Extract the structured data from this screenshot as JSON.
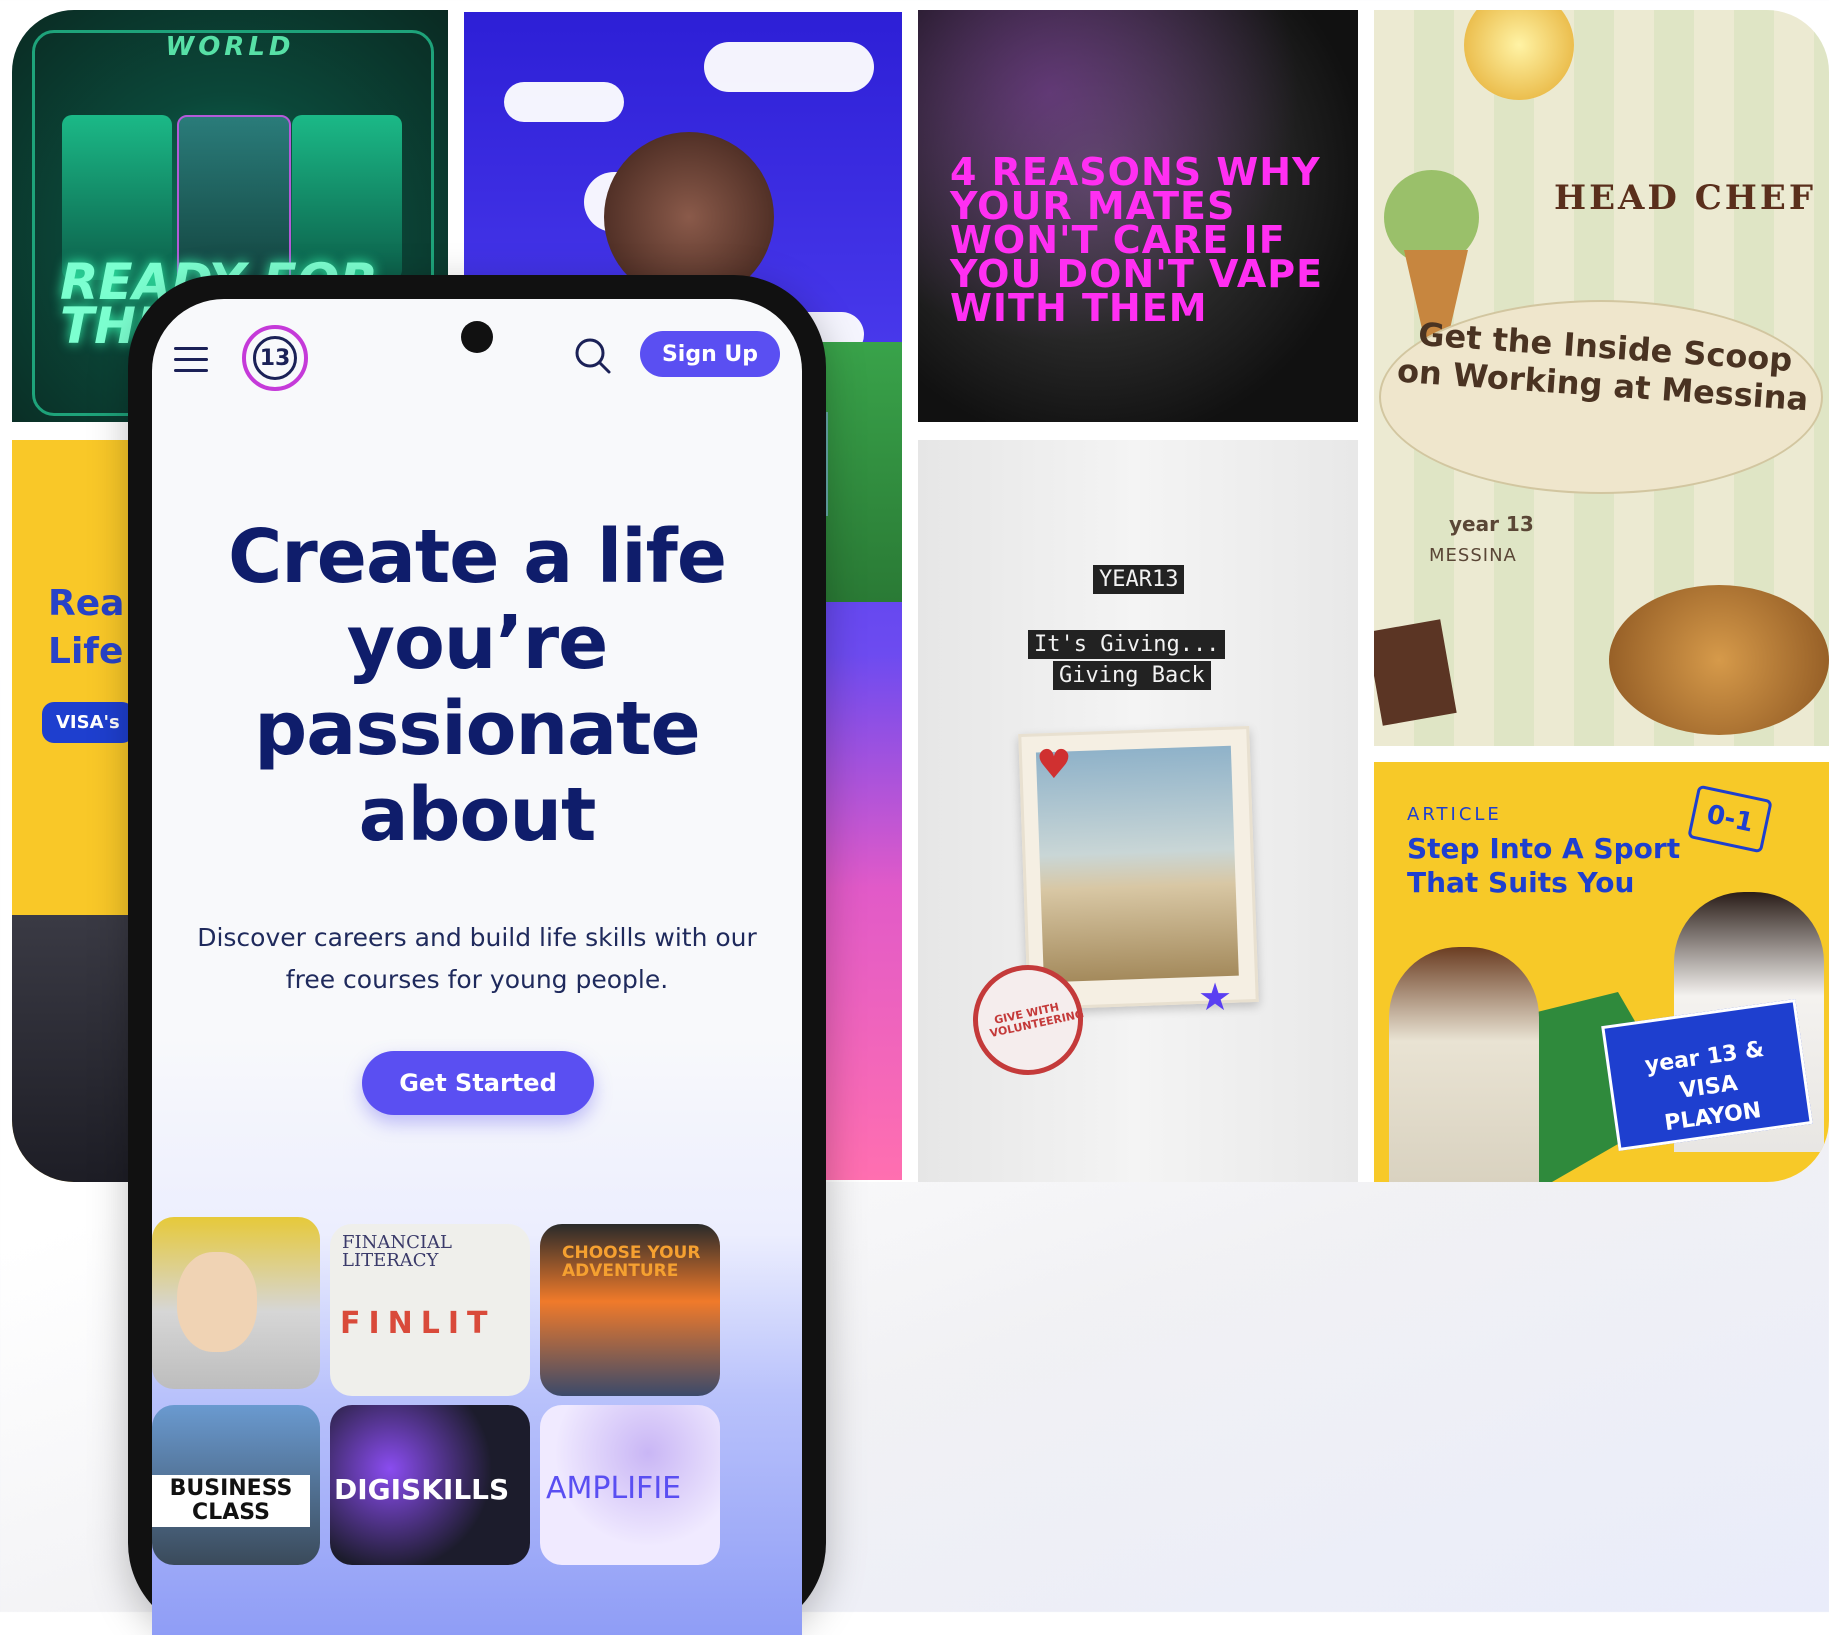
{
  "tiles": {
    "world": {
      "title": "WORLD",
      "big_text": "READY FOR THE NEXT"
    },
    "vape": {
      "headline": "4 REASONS WHY YOUR MATES WON'T CARE IF YOU DON'T VAPE WITH THEM"
    },
    "chef": {
      "title": "HEAD CHEF",
      "headline": "Get the Inside Scoop on Working at Messina",
      "brand": "year 13",
      "partner": "MESSINA"
    },
    "life": {
      "headline_1": "Rea",
      "headline_2": "Life",
      "pill": "VISA's"
    },
    "giving": {
      "brand": "YEAR13",
      "line1": "It's Giving...",
      "line2": "Giving Back",
      "stamp": "GIVE WITH VOLUNTEERING"
    },
    "sport": {
      "kicker": "ARTICLE",
      "headline_1": "Step Into A Sport",
      "headline_2": "That Suits You",
      "score": "0-1",
      "sign": "year 13 & VISA PLAYON"
    }
  },
  "phone": {
    "logo_text": "13",
    "signup_label": "Sign Up",
    "hero_title": "Create a life you’re passionate about",
    "subtitle": "Discover careers and build life skills with our free courses for young people.",
    "cta_label": "Get Started",
    "courses": [
      {
        "label": ""
      },
      {
        "label": "FINLIT",
        "kicker": "FINANCIAL LITERACY"
      },
      {
        "label": "CHOOSE YOUR ADVENTURE"
      },
      {
        "label": "BUSINESS CLASS"
      },
      {
        "label": "DIGISKILLS"
      },
      {
        "label": "AMPLIFIE"
      }
    ]
  },
  "colors": {
    "accent": "#5a4ff2",
    "navy": "#0f1d6b",
    "magenta": "#ff2ff2",
    "yellow": "#f7c928",
    "blue": "#1e3fcf"
  }
}
